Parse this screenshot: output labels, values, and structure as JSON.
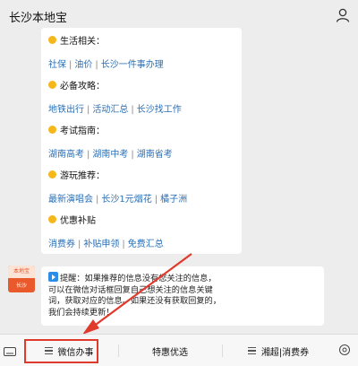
{
  "header": {
    "title": "长沙本地宝",
    "user_icon": "user-icon"
  },
  "menu_card": {
    "sections": [
      {
        "title": "生活相关：",
        "links": [
          "社保",
          "油价",
          "长沙一件事办理"
        ]
      },
      {
        "title": "必备攻略：",
        "links": [
          "地铁出行",
          "活动汇总",
          "长沙找工作"
        ]
      },
      {
        "title": "考试指南：",
        "links": [
          "湖南高考",
          "湖南中考",
          "湖南省考"
        ]
      },
      {
        "title": "游玩推荐：",
        "links": [
          "最新演唱会",
          "长沙1元烟花",
          "橘子洲"
        ]
      },
      {
        "title": "优惠补贴",
        "links": [
          "消费券",
          "补贴申领",
          "免费汇总"
        ]
      }
    ]
  },
  "avatar": {
    "top_text": "本地宝",
    "bottom_text": "长沙"
  },
  "notice": {
    "lines": [
      "提醒：如果推荐的信息没有您关注的信息，",
      "可以在微信对话框回复自己想关注的信息关键",
      "词，获取对应的信息。如果还没有获取回复的，",
      "我们会持续更新！"
    ]
  },
  "bottom_menu": {
    "items": [
      "微信办事",
      "特惠优选",
      "湘超|消费券"
    ]
  },
  "colors": {
    "link": "#2b6fb5",
    "highlight": "#e03a2c",
    "dot": "#f5b71a"
  }
}
